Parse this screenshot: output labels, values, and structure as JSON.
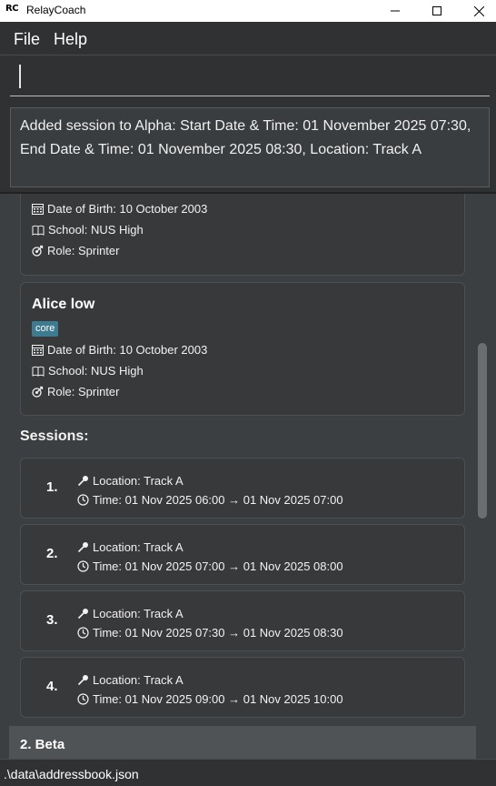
{
  "window": {
    "logo": "RC",
    "title": "RelayCoach"
  },
  "menu": {
    "file": "File",
    "help": "Help"
  },
  "command": {
    "value": ""
  },
  "result": {
    "text": "Added session to Alpha: Start Date & Time: 01 November 2025 07:30,\nEnd Date & Time: 01 November 2025 08:30, Location: Track A"
  },
  "persons": [
    {
      "dob": "Date of Birth: 10 October 2003",
      "school": "School: NUS High",
      "role": "Role: Sprinter"
    },
    {
      "name": "Alice low",
      "tag": "core",
      "dob": "Date of Birth: 10 October 2003",
      "school": "School: NUS High",
      "role": "Role: Sprinter"
    }
  ],
  "sessions_title": "Sessions:",
  "sessions": [
    {
      "num": "1.",
      "location": "Location: Track A",
      "time": "Time: 01 Nov 2025 06:00 → 01 Nov 2025 07:00"
    },
    {
      "num": "2.",
      "location": "Location: Track A",
      "time": "Time: 01 Nov 2025 07:00 → 01 Nov 2025 08:00"
    },
    {
      "num": "3.",
      "location": "Location: Track A",
      "time": "Time: 01 Nov 2025 07:30 → 01 Nov 2025 08:30"
    },
    {
      "num": "4.",
      "location": "Location: Track A",
      "time": "Time: 01 Nov 2025 09:00 → 01 Nov 2025 10:00"
    }
  ],
  "next_group": {
    "label": "2.  Beta"
  },
  "status": {
    "path": ".\\data\\addressbook.json"
  }
}
